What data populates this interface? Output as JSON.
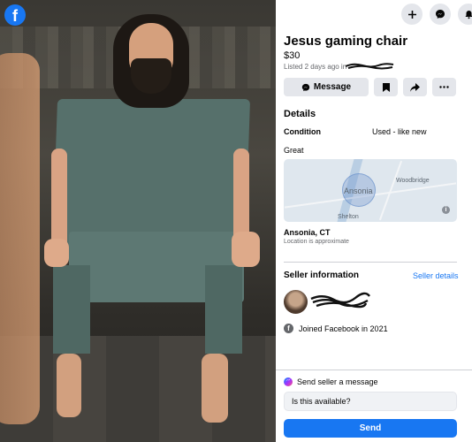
{
  "app": {
    "logo_letter": "f"
  },
  "header": {
    "icons": [
      "plus-icon",
      "messenger-icon",
      "notifications-icon"
    ]
  },
  "listing": {
    "title": "Jesus gaming chair",
    "price": "$30",
    "listed": "Listed 2 days ago in",
    "actions": {
      "message_label": "Message"
    },
    "details_heading": "Details",
    "condition_label": "Condition",
    "condition_value": "Used - like new",
    "description": "Great",
    "map": {
      "labels": {
        "ansonia": "Ansonia",
        "woodbridge": "Woodbridge",
        "shelton": "Shelton"
      },
      "info_glyph": "i"
    },
    "location": "Ansonia, CT",
    "location_note": "Location is approximate"
  },
  "seller": {
    "heading": "Seller information",
    "details_link": "Seller details",
    "joined": "Joined Facebook in 2021"
  },
  "compose": {
    "heading": "Send seller a message",
    "input_value": "Is this available?",
    "send_label": "Send"
  },
  "colors": {
    "accent": "#1877f2",
    "button_bg": "#e4e6eb",
    "muted_text": "#65676b"
  }
}
